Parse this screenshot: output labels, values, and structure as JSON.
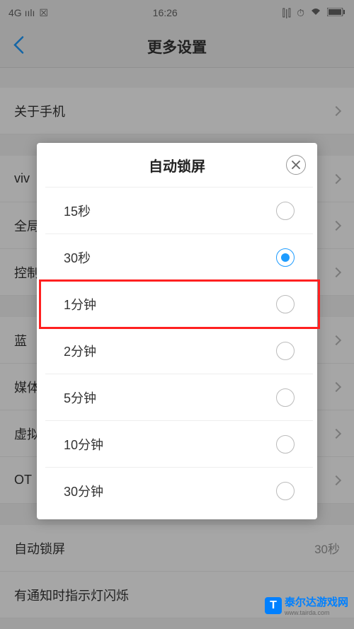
{
  "status_bar": {
    "signal": "4G ıılı",
    "camera": "☒",
    "time": "16:26",
    "vibrate": "📳",
    "alarm": "⏰",
    "wifi": "📶",
    "battery": "▮▯"
  },
  "header": {
    "title": "更多设置"
  },
  "list": {
    "items": [
      {
        "label": "关于手机"
      },
      {
        "label": "viv"
      },
      {
        "label": "全局"
      },
      {
        "label": "控制"
      },
      {
        "label": "蓝"
      },
      {
        "label": "媒体"
      },
      {
        "label": "虚拟"
      },
      {
        "label": "OT"
      },
      {
        "label": "自动锁屏",
        "value": "30秒"
      },
      {
        "label": "有通知时指示灯闪烁"
      }
    ]
  },
  "modal": {
    "title": "自动锁屏",
    "options": [
      {
        "label": "15秒",
        "selected": false
      },
      {
        "label": "30秒",
        "selected": true
      },
      {
        "label": "1分钟",
        "selected": false,
        "highlighted": true
      },
      {
        "label": "2分钟",
        "selected": false
      },
      {
        "label": "5分钟",
        "selected": false
      },
      {
        "label": "10分钟",
        "selected": false
      },
      {
        "label": "30分钟",
        "selected": false
      }
    ]
  },
  "watermark": {
    "text": "泰尔达游戏网",
    "url": "www.tairda.com",
    "icon": "T"
  }
}
